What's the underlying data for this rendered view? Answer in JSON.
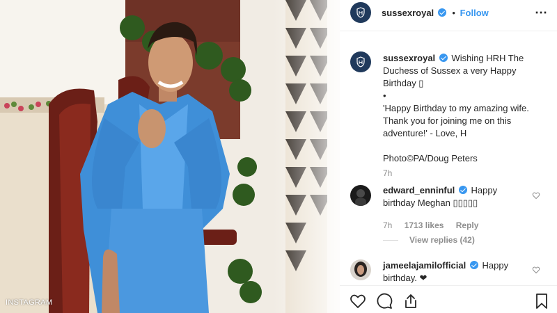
{
  "photo": {
    "watermark": "INSTAGRAM"
  },
  "header": {
    "username": "sussexroyal",
    "separator": "•",
    "follow_label": "Follow",
    "more_label": "⋯"
  },
  "caption": {
    "username": "sussexroyal",
    "line1": "Wishing HRH The Duchess of Sussex a very Happy Birthday ▯",
    "bullet": "•",
    "quote": "'Happy Birthday to my amazing wife. Thank you for joining me on this adventure!' - Love, H",
    "credit": "Photo©PA/Doug Peters",
    "time": "7h"
  },
  "comments": [
    {
      "username": "edward_enninful",
      "text": "Happy birthday Meghan ▯▯▯▯▯",
      "time": "7h",
      "likes": "1713 likes",
      "reply": "Reply",
      "view_replies": "View replies (42)"
    },
    {
      "username": "jameelajamilofficial",
      "text": "Happy birthday. ❤"
    }
  ],
  "icons": {
    "verified": "verified-badge",
    "like": "heart-icon",
    "comment": "comment-icon",
    "share": "share-icon",
    "save": "bookmark-icon",
    "comment_like": "small-heart-icon"
  },
  "colors": {
    "accent": "#3897f0",
    "muted": "#8e8e8e",
    "avatar_bg": "#203a5c"
  }
}
